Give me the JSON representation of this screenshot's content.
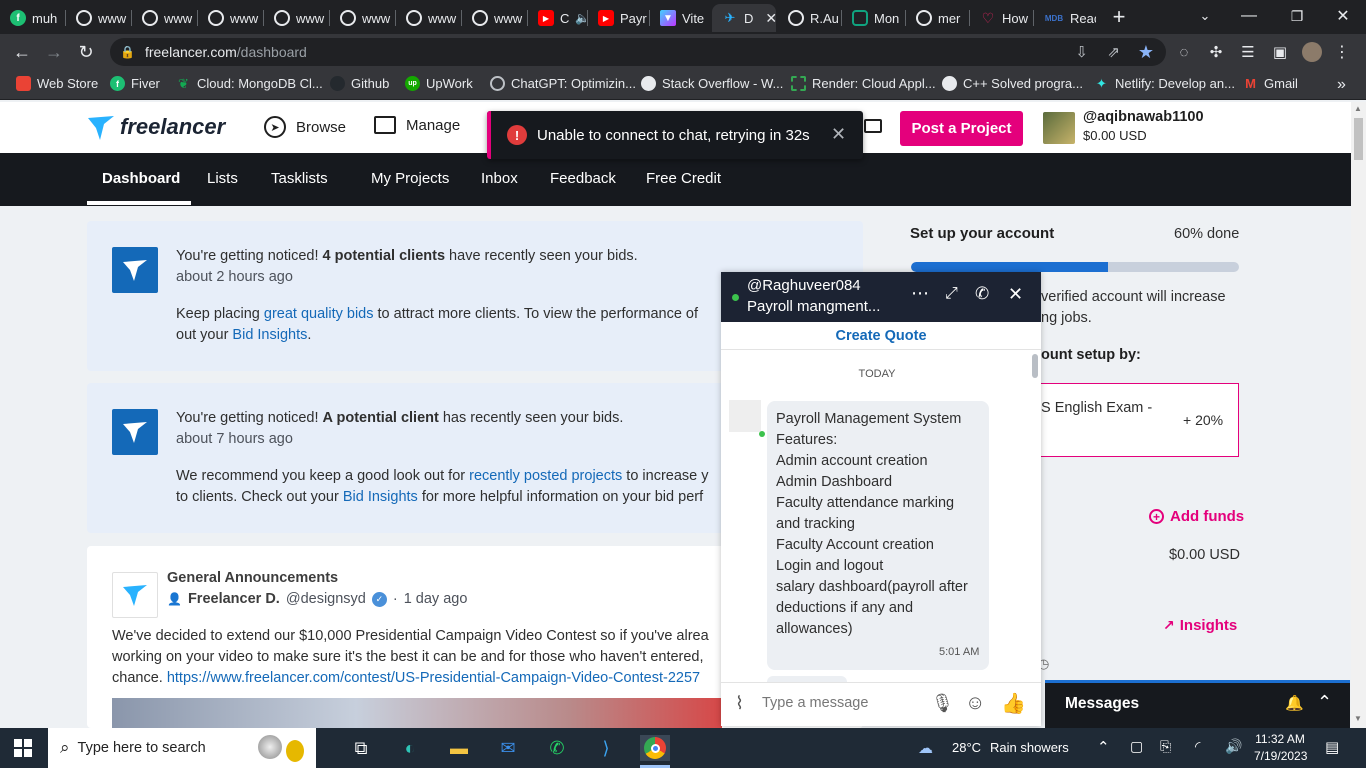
{
  "browser": {
    "tabs": [
      {
        "label": "muh",
        "icon": "fiverr-icon"
      },
      {
        "label": "www",
        "icon": "globe-icon"
      },
      {
        "label": "www",
        "icon": "globe-icon"
      },
      {
        "label": "www",
        "icon": "globe-icon"
      },
      {
        "label": "www",
        "icon": "globe-icon"
      },
      {
        "label": "www",
        "icon": "globe-icon"
      },
      {
        "label": "www",
        "icon": "globe-icon"
      },
      {
        "label": "www",
        "icon": "globe-icon"
      },
      {
        "label": "C",
        "icon": "youtube-icon"
      },
      {
        "label": "Payr",
        "icon": "youtube-icon"
      },
      {
        "label": "Vite",
        "icon": "vite-icon"
      },
      {
        "label": "D",
        "icon": "freelancer-icon"
      },
      {
        "label": "R.Au",
        "icon": "github-icon"
      },
      {
        "label": "Mon",
        "icon": "chatgpt-icon"
      },
      {
        "label": "mer",
        "icon": "github-icon"
      },
      {
        "label": "How",
        "icon": "heart-icon"
      },
      {
        "label": "Reac",
        "icon": "mdb-icon"
      }
    ],
    "url_domain": "freelancer.com",
    "url_path": "/dashboard",
    "bookmarks": [
      {
        "label": "Web Store"
      },
      {
        "label": "Fiver"
      },
      {
        "label": "Cloud: MongoDB Cl..."
      },
      {
        "label": "Github"
      },
      {
        "label": "UpWork"
      },
      {
        "label": "ChatGPT: Optimizin..."
      },
      {
        "label": "Stack Overflow - W..."
      },
      {
        "label": "Render: Cloud Appl..."
      },
      {
        "label": "C++ Solved progra..."
      },
      {
        "label": "Netlify: Develop an..."
      },
      {
        "label": "Gmail"
      }
    ],
    "more_bookmarks": "»"
  },
  "header": {
    "logo_text": "freelancer",
    "browse": "Browse",
    "manage": "Manage",
    "post_project": "Post a Project",
    "username": "@aqibnawab1100",
    "balance": "$0.00 USD"
  },
  "toast": {
    "message": "Unable to connect to chat, retrying in 32s"
  },
  "nav": [
    "Dashboard",
    "Lists",
    "Tasklists",
    "My Projects",
    "Inbox",
    "Feedback",
    "Free Credit"
  ],
  "notices": [
    {
      "line1_a": "You're getting noticed! ",
      "line1_b": "4 potential clients",
      "line1_c": " have recently seen your bids.",
      "time": "about 2 hours ago",
      "line2_a": "Keep placing ",
      "line2_link": "great quality bids",
      "line2_b": " to attract more clients. To view the performance of",
      "line3_a": "out your ",
      "line3_link": "Bid Insights",
      "line3_b": "."
    },
    {
      "line1_a": "You're getting noticed! ",
      "line1_b": "A potential client",
      "line1_c": " has recently seen your bids.",
      "time": "about 7 hours ago",
      "line2_a": "We recommend you keep a good look out for ",
      "line2_link": "recently posted projects",
      "line2_b": " to increase y",
      "line3_a": "to clients. Check out your ",
      "line3_link": "Bid Insights",
      "line3_b": " for more helpful information on your bid perf"
    }
  ],
  "announcement": {
    "title": "General Announcements",
    "author": "Freelancer D.",
    "handle": "@designsyd",
    "time": "1 day ago",
    "line1": "We've decided to extend our $10,000 Presidential Campaign Video Contest so if you've alrea",
    "line2": "working on your video to make sure it's the best it can be and for those who haven't entered,",
    "line3_a": "chance. ",
    "line3_link": "https://www.freelancer.com/contest/US-Presidential-Campaign-Video-Contest-2257"
  },
  "account": {
    "title": "Set up your account",
    "percent_label": "60% done",
    "progress": 0.6,
    "desc_line1": "verified account will increase",
    "desc_line2": "ng jobs.",
    "setup_by": "ount setup by:",
    "exam": "S English Exam -",
    "exam_bonus": "+ 20%",
    "add_funds": "Add funds",
    "balance": "$0.00 USD",
    "insights": "Insights"
  },
  "chat": {
    "username": "@Raghuveer084",
    "subject": "Payroll mangment...",
    "create_quote": "Create Quote",
    "day": "TODAY",
    "message_lines": [
      "Payroll Management System",
      "Features:",
      "Admin account creation",
      "Admin Dashboard",
      "Faculty attendance marking",
      "and tracking",
      "Faculty Account creation",
      "Login and logout",
      "salary dashboard(payroll after",
      "deductions if any and",
      "allowances)"
    ],
    "message_time": "5:01 AM",
    "input_placeholder": "Type a message"
  },
  "messages_bar": {
    "label": "Messages"
  },
  "taskbar": {
    "search_placeholder": "Type here to search",
    "weather_temp": "28°C",
    "weather_desc": "Rain showers",
    "time": "11:32 AM",
    "date": "7/19/2023"
  },
  "colors": {
    "brand_blue": "#1469b8",
    "brand_pink": "#e4007c",
    "dark_nav": "#16191e",
    "card_bg": "#e7eef9"
  }
}
